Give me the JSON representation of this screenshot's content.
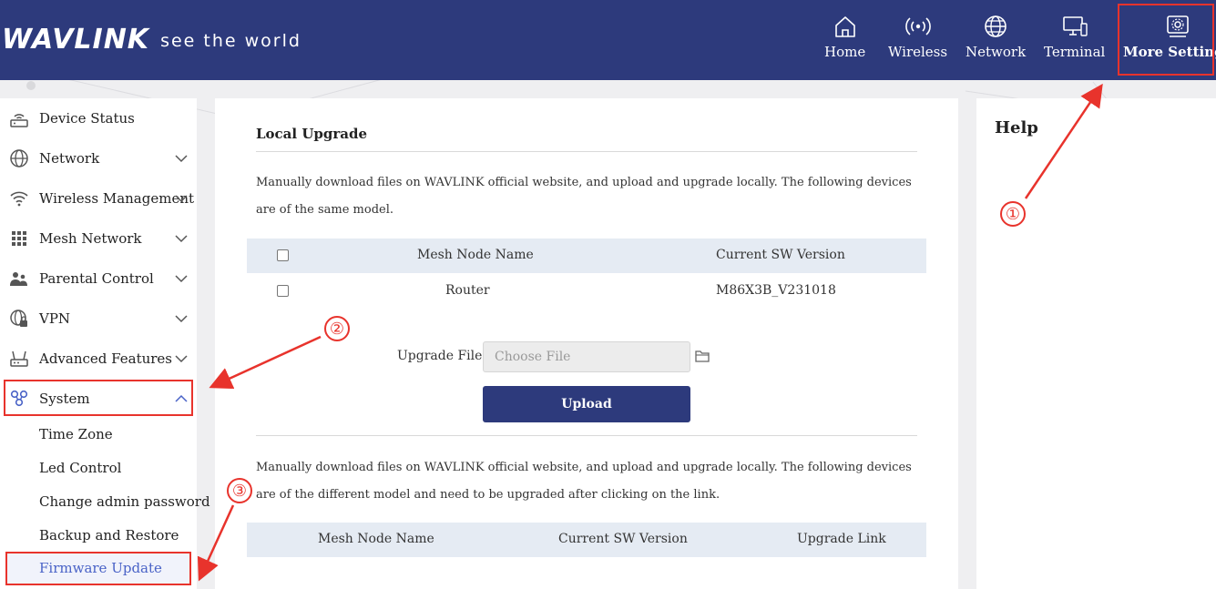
{
  "header": {
    "brand": "WAVLINK",
    "tagline": "see the world",
    "nav": [
      {
        "label": "Home",
        "icon": "home-icon"
      },
      {
        "label": "Wireless",
        "icon": "wireless-icon"
      },
      {
        "label": "Network",
        "icon": "globe-icon"
      },
      {
        "label": "Terminal",
        "icon": "terminal-icon"
      },
      {
        "label": "More Settings",
        "icon": "settings-icon",
        "active": true
      }
    ]
  },
  "sidebar": {
    "items": [
      {
        "label": "Device Status",
        "icon": "device-status-icon"
      },
      {
        "label": "Network",
        "icon": "globe-icon"
      },
      {
        "label": "Wireless Management",
        "icon": "wifi-icon"
      },
      {
        "label": "Mesh Network",
        "icon": "mesh-grid-icon"
      },
      {
        "label": "Parental Control",
        "icon": "parental-icon"
      },
      {
        "label": "VPN",
        "icon": "vpn-icon"
      },
      {
        "label": "Advanced Features",
        "icon": "router-icon"
      },
      {
        "label": "System",
        "icon": "system-icon",
        "expanded": true
      }
    ],
    "subitems": [
      {
        "label": "Time Zone"
      },
      {
        "label": "Led Control"
      },
      {
        "label": "Change admin password"
      },
      {
        "label": "Backup and Restore"
      },
      {
        "label": "Firmware Update",
        "active": true
      }
    ]
  },
  "main": {
    "title": "Local Upgrade",
    "desc_same_model": "Manually download files on WAVLINK official website, and upload and upgrade locally. The following devices are of the same model.",
    "table_same": {
      "headers": [
        "Mesh Node Name",
        "Current SW Version"
      ],
      "rows": [
        {
          "name": "Router",
          "version": "M86X3B_V231018"
        }
      ]
    },
    "upgrade_file_label": "Upgrade File",
    "choose_file_placeholder": "Choose File",
    "upload_button": "Upload",
    "desc_diff_model": "Manually download files on WAVLINK official website, and upload and upgrade locally. The following devices are of the different model and need to be upgraded after clicking on the link.",
    "table_diff": {
      "headers": [
        "Mesh Node Name",
        "Current SW Version",
        "Upgrade Link"
      ]
    }
  },
  "help": {
    "title": "Help"
  },
  "annotations": {
    "step1": "①",
    "step2": "②",
    "step3": "③"
  },
  "colors": {
    "header_bg": "#2d3a7c",
    "accent": "#4a63c7",
    "annotation": "#e8332c",
    "table_head_bg": "#e5ebf3"
  }
}
